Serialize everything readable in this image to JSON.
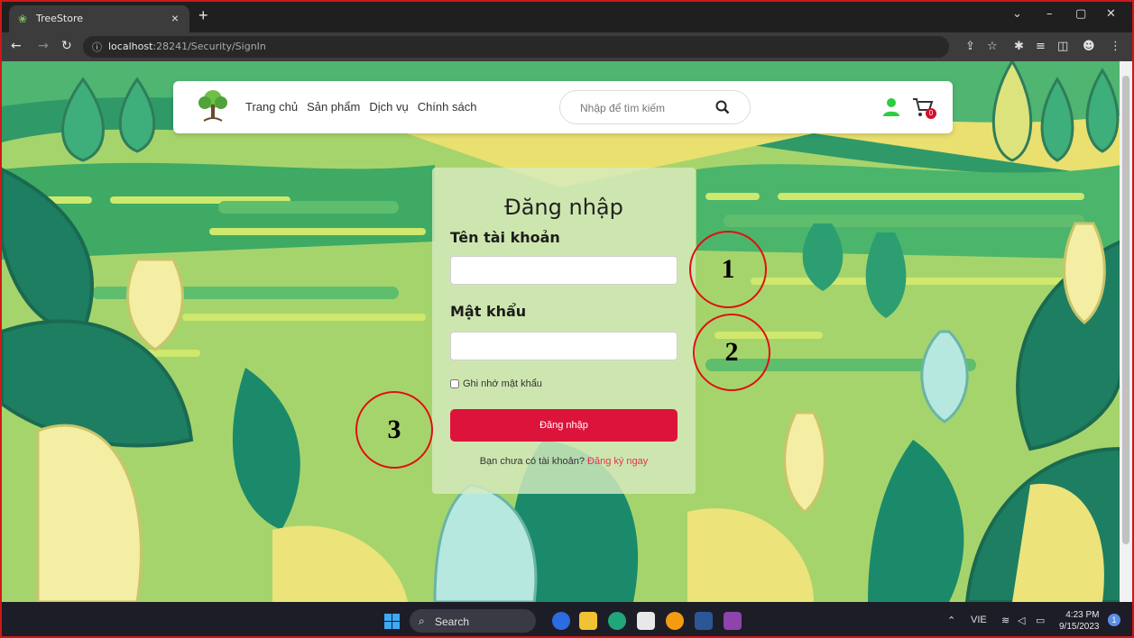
{
  "browser": {
    "tab_title": "TreeStore",
    "tab_close": "×",
    "new_tab": "+",
    "url_host": "localhost",
    "url_rest": ":28241/Security/SignIn",
    "win_controls": [
      "⌄",
      "–",
      "▢",
      "✕"
    ]
  },
  "site": {
    "nav": [
      "Trang chủ",
      "Sản phẩm",
      "Dịch vụ",
      "Chính sách"
    ],
    "search_placeholder": "Nhập để tìm kiếm",
    "cart_count": "0",
    "colors": {
      "accent": "#dc143c",
      "user_icon": "#2ecc40"
    }
  },
  "login": {
    "title": "Đăng nhập",
    "username_label": "Tên tài khoản",
    "password_label": "Mật khẩu",
    "remember_label": "Ghi nhớ mật khẩu",
    "submit_label": "Đăng nhập",
    "no_account_text": "Bạn chưa có tài khoản?",
    "register_link": "Đăng ký ngay"
  },
  "annotations": [
    "1",
    "2",
    "3"
  ],
  "taskbar": {
    "search_label": "Search",
    "language": "VIE",
    "time": "4:23 PM",
    "date": "9/15/2023",
    "notification_count": "1"
  }
}
